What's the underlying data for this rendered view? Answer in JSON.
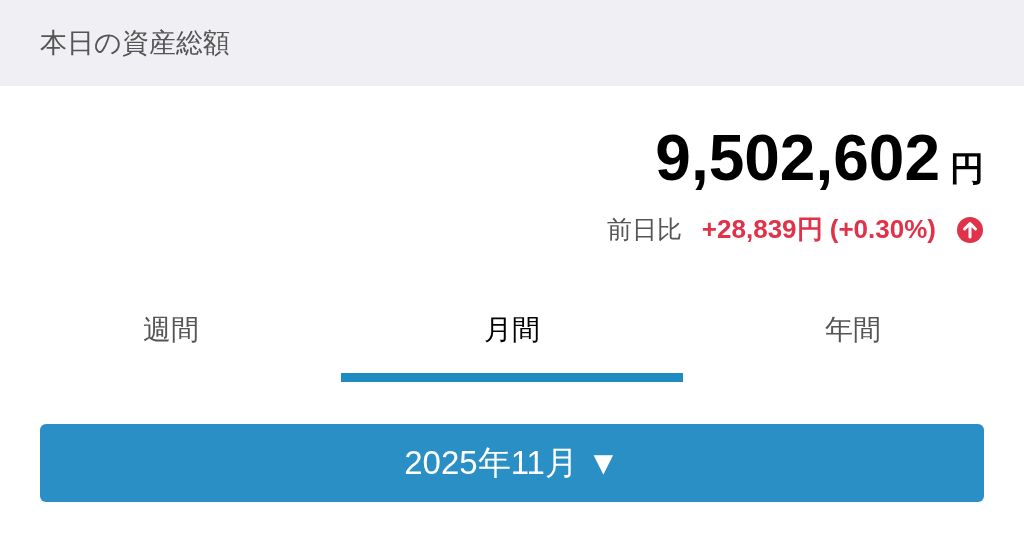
{
  "header": {
    "title": "本日の資産総額"
  },
  "total": {
    "amount": "9,502,602",
    "unit": "円"
  },
  "change": {
    "label": "前日比",
    "value": "+28,839円 (+0.30%)",
    "rising": true
  },
  "tabs": [
    {
      "label": "週間",
      "selected": false
    },
    {
      "label": "月間",
      "selected": true
    },
    {
      "label": "年間",
      "selected": false
    }
  ],
  "period_button": {
    "label": "2025年11月 ▼"
  }
}
